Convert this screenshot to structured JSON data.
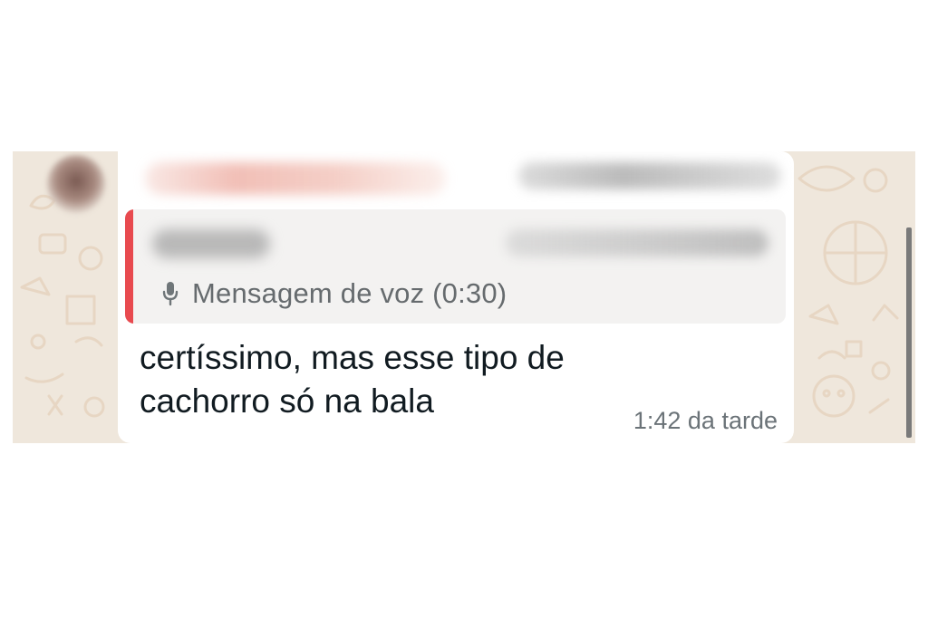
{
  "chat": {
    "quoted": {
      "label": "Mensagem de voz (0:30)",
      "icon": "mic-icon",
      "accent_color": "#e84a4f"
    },
    "message": {
      "line1": "certíssimo, mas esse tipo de",
      "line2": "cachorro só na bala",
      "time": "1:42 da tarde"
    },
    "colors": {
      "bubble": "#ffffff",
      "wallpaper": "#efe7dc",
      "quote_background": "#f3f2f1"
    }
  }
}
